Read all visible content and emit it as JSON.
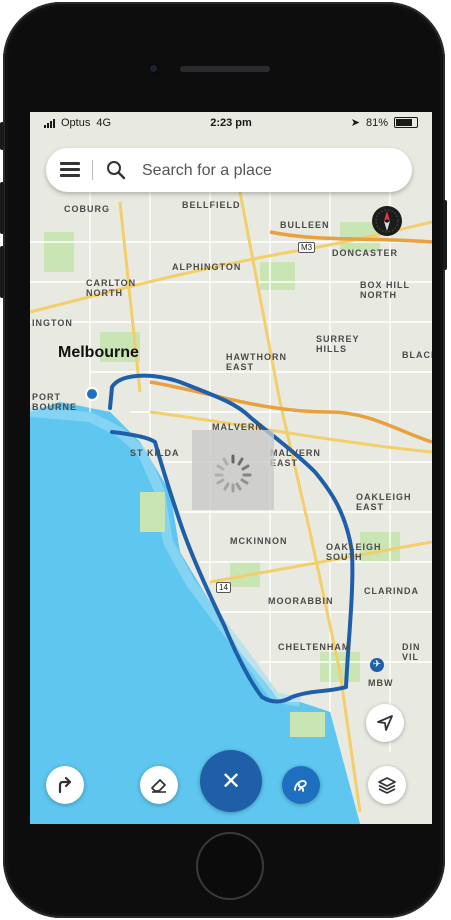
{
  "status_bar": {
    "carrier": "Optus",
    "network": "4G",
    "time": "2:23 pm",
    "battery": "81%"
  },
  "search": {
    "placeholder": "Search for a place"
  },
  "map": {
    "labels": {
      "coburg": "COBURG",
      "bellfield": "BELLFIELD",
      "bulleen": "BULLEEN",
      "doncaster": "DONCASTER",
      "alphington": "ALPHINGTON",
      "carlton_north": "CARLTON NORTH",
      "box_hill_north": "BOX HILL NORTH",
      "flemington": "INGTON",
      "surrey_hills": "SURREY HILLS",
      "melbourne": "Melbourne",
      "hawthorn_east": "HAWTHORN EAST",
      "blackburn": "BLACK",
      "port_melbourne": "PORT BOURNE",
      "st_kilda": "ST KILDA",
      "malvern": "MALVERN",
      "malvern_east": "MALVERN EAST",
      "oakleigh_east": "OAKLEIGH EAST",
      "mckinnon": "MCKINNON",
      "oakleigh_south": "OAKLEIGH SOUTH",
      "clarinda": "CLARINDA",
      "moorabbin": "MOORABBIN",
      "cheltenham": "CHELTENHAM",
      "dingley": "DIN VIL",
      "mbw": "MBW"
    },
    "road_shields": {
      "m3": "M3",
      "r14": "14"
    }
  },
  "colors": {
    "water": "#5ec6ef",
    "land": "#e8eae1",
    "drawn_path": "#1f5ea8",
    "primary_button": "#1e5fa8",
    "park": "#c9e5b4"
  },
  "icons": {
    "menu": "menu-icon",
    "search": "search-icon",
    "compass": "compass-icon",
    "locate": "navigation-arrow-icon",
    "directions": "turn-right-arrow-icon",
    "eraser": "eraser-icon",
    "close": "close-icon",
    "lasso": "lasso-draw-icon",
    "layers": "layers-icon"
  }
}
